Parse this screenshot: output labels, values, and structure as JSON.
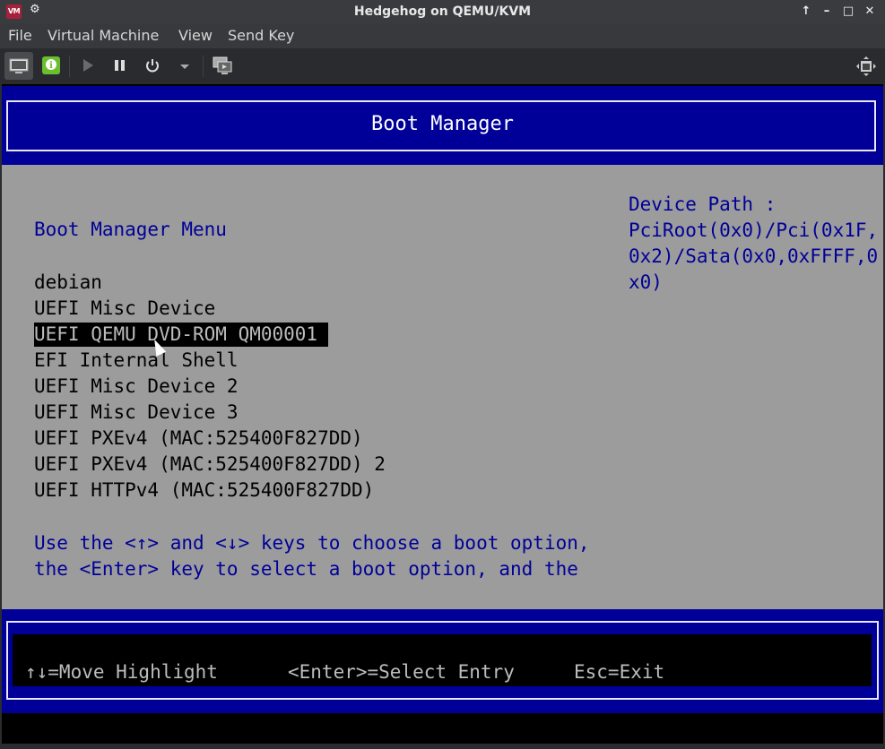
{
  "window": {
    "title": "Hedgehog on QEMU/KVM",
    "logo": "VM"
  },
  "menubar": [
    "File",
    "Virtual Machine",
    "View",
    "Send Key"
  ],
  "toolbar": {
    "icons": [
      "monitor-icon",
      "info-icon",
      "play-icon",
      "pause-icon",
      "power-icon",
      "dropdown-icon",
      "screenshot-icon",
      "fullscreen-icon"
    ]
  },
  "bios": {
    "header_title": "Boot Manager",
    "menu_title": "Boot Manager Menu",
    "entries": [
      "debian",
      "UEFI Misc Device",
      "UEFI QEMU DVD-ROM QM00001",
      "EFI Internal Shell",
      "UEFI Misc Device 2",
      "UEFI Misc Device 3",
      "UEFI PXEv4 (MAC:525400F827DD)",
      "UEFI PXEv4 (MAC:525400F827DD) 2",
      "UEFI HTTPv4 (MAC:525400F827DD)"
    ],
    "selected_index": 2,
    "device_path": "Device Path :\nPciRoot(0x0)/Pci(0x1F,\n0x2)/Sata(0x0,0xFFFF,0\nx0)",
    "help_text": "Use the <↑> and <↓> keys to choose a boot option,\nthe <Enter> key to select a boot option, and the",
    "footer": {
      "move": "↑↓=Move Highlight",
      "select": "<Enter>=Select Entry",
      "exit": "Esc=Exit"
    }
  },
  "colors": {
    "bios_blue": "#000098",
    "bios_gray": "#9c9c9c",
    "vm_logo": "#a8213c"
  }
}
